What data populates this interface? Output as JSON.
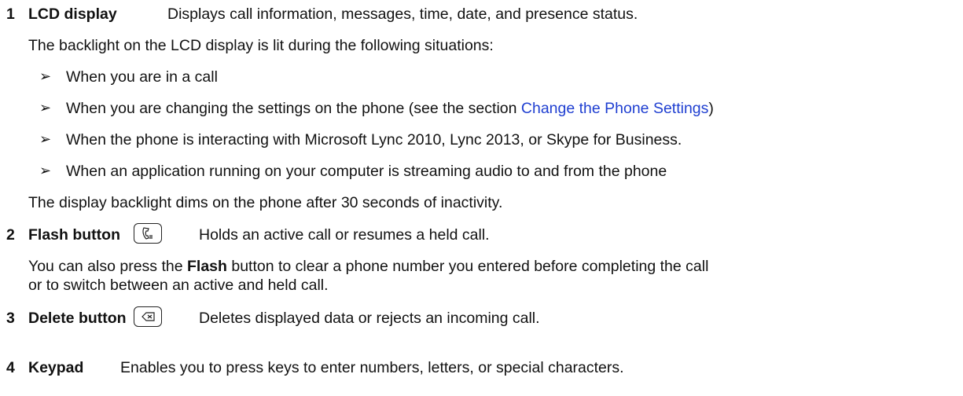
{
  "items": [
    {
      "num": "1",
      "term": "LCD display",
      "desc": "Displays call information, messages, time, date, and presence status.",
      "intro": "The backlight on the LCD display is lit during the following situations:",
      "bullets": [
        "When you are in a call",
        "When you are changing the settings on the phone (see the section ",
        "When the phone is interacting with Microsoft Lync 2010, Lync 2013, or Skype for Business.",
        "When an application running on your computer is streaming audio to and from the phone"
      ],
      "link_text": "Change the Phone Settings",
      "link_suffix": ")",
      "outro": "The display backlight dims on the phone after 30 seconds of inactivity."
    },
    {
      "num": "2",
      "term": "Flash button",
      "desc": "Holds an active call or resumes a held call.",
      "note_pre": "You can also press the ",
      "note_bold": "Flash",
      "note_post": " button to clear a phone number you entered before completing the call",
      "note_line2": "or to switch between an active and held call.",
      "icon": "flash-handset-icon"
    },
    {
      "num": "3",
      "term": "Delete button",
      "desc": "Deletes displayed data or rejects an incoming call.",
      "icon": "delete-backspace-icon"
    },
    {
      "num": "4",
      "term": "Keypad",
      "desc": "Enables you to press keys to enter numbers, letters, or special characters."
    }
  ],
  "bullet_glyph": "➢"
}
